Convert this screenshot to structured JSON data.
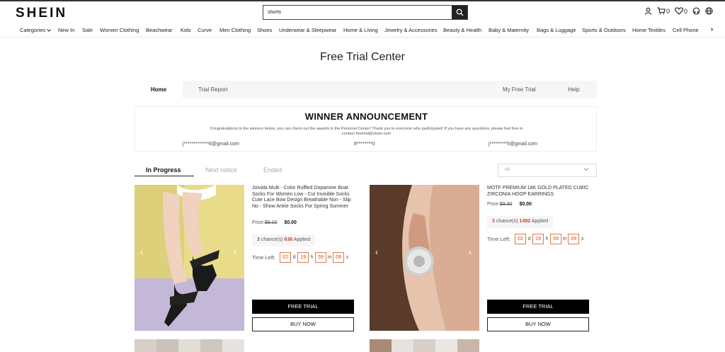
{
  "header": {
    "logo": "SHEIN",
    "search_value": "shorts",
    "search_icon": "search-icon",
    "icons": [
      {
        "name": "account-icon"
      },
      {
        "name": "cart-icon",
        "count": "0"
      },
      {
        "name": "wishlist-icon",
        "count": "0"
      },
      {
        "name": "support-icon"
      },
      {
        "name": "globe-icon"
      }
    ]
  },
  "nav": {
    "items": [
      "Categories",
      "New In",
      "Sale",
      "Women Clothing",
      "Beachwear",
      "Kids",
      "Curve",
      "Men Clothing",
      "Shoes",
      "Underwear & Sleepwear",
      "Home & Living",
      "Jewelry & Accessories",
      "Beauty & Health",
      "Baby & Maternity",
      "Bags & Luggage",
      "Sports & Outdoors",
      "Home Textiles",
      "Cell Phone"
    ],
    "next_icon": "chevron-right-icon"
  },
  "page_title": "Free Trial Center",
  "tabs": {
    "home": "Home",
    "trial_report": "Trial Report",
    "my_free_trial": "My Free Trial",
    "help": "Help"
  },
  "winner": {
    "title": "WINNER ANNOUNCEMENT",
    "description": "Congratulations to the winners below, you can check out the awards in the Personal Center! Thank you to everyone who participated! If you have any questions, please feel free to contact freetrial@shein.com",
    "emails": [
      "j*************6@gmail.com",
      "8********0",
      "j*********5@gmail.com"
    ]
  },
  "sub_tabs": {
    "in_progress": "In Progress",
    "next_notice": "Next notice",
    "ended": "Ended"
  },
  "filter": {
    "selected": "All"
  },
  "products": [
    {
      "title": "Joivida Multi - Color Ruffled Dopamine Boat Socks For Women Low - Cut Invisible Socks Cute Lace Bow Design Breathable Non - Slip No - Show Ankle Socks For Spring Summer",
      "price_label": "Price:",
      "price_old": "$9.10",
      "price_now": "$0.00",
      "chances": "3",
      "chance_text": "chance(s)",
      "applied": "636",
      "applied_text": "Applied",
      "time_label": "Time Left:",
      "time": {
        "d": "02",
        "h": "19",
        "m": "59",
        "s": "09"
      },
      "free_trial": "FREE TRIAL",
      "buy_now": "BUY NOW"
    },
    {
      "title": "MOTF PREMIUM 18K GOLD PLATED CUBIC ZIRCONIA HOOP EARRINGS",
      "price_label": "Price:",
      "price_old": "$9.30",
      "price_now": "$0.00",
      "chances": "3",
      "chance_text": "chance(s)",
      "applied": "1492",
      "applied_text": "Applied",
      "time_label": "Time Left:",
      "time": {
        "d": "02",
        "h": "19",
        "m": "59",
        "s": "09"
      },
      "free_trial": "FREE TRIAL",
      "buy_now": "BUY NOW"
    }
  ],
  "units": {
    "d": "d",
    "h": "h",
    "m": "m",
    "s": "s"
  },
  "colors": {
    "accent": "#c44d1c",
    "timer_border": "#e07a4a",
    "button": "#000000"
  }
}
